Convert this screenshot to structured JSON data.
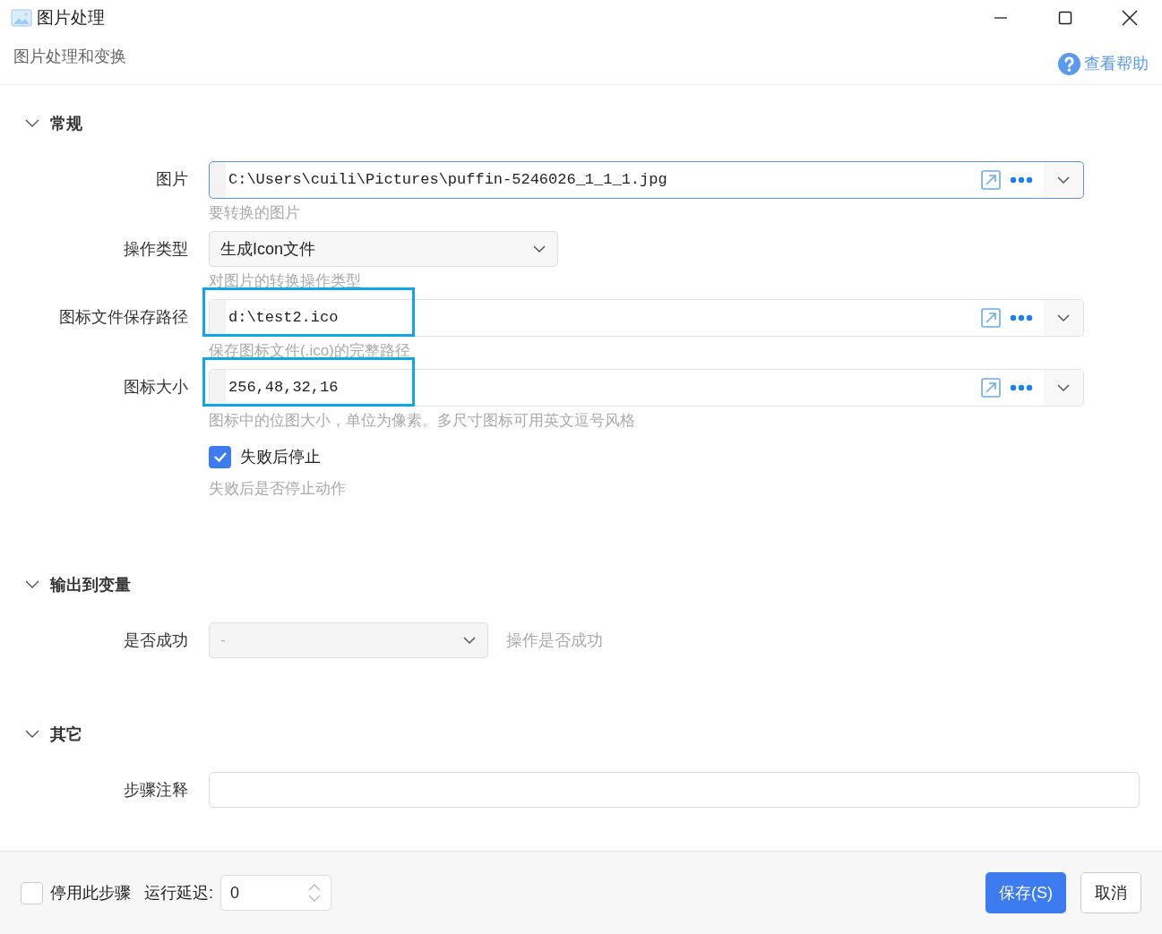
{
  "window": {
    "title": "图片处理",
    "subtitle": "图片处理和变换",
    "help": "查看帮助"
  },
  "sections": [
    {
      "title": "常规",
      "expanded": true,
      "fields": [
        {
          "kind": "path",
          "label": "图片",
          "value": "C:\\Users\\cuili\\Pictures\\puffin-5246026_1_1_1.jpg",
          "hint": "要转换的图片",
          "focused": true,
          "highlighted": false
        },
        {
          "kind": "select",
          "label": "操作类型",
          "value": "生成Icon文件",
          "hint": "对图片的转换操作类型"
        },
        {
          "kind": "path",
          "label": "图标文件保存路径",
          "value": "d:\\test2.ico",
          "hint": "保存图标文件(.ico)的完整路径",
          "focused": false,
          "highlighted": true
        },
        {
          "kind": "path",
          "label": "图标大小",
          "value": "256,48,32,16",
          "hint": "图标中的位图大小，单位为像素。多尺寸图标可用英文逗号风格",
          "focused": false,
          "highlighted": true
        },
        {
          "kind": "checkbox",
          "label": "失败后停止",
          "checked": true,
          "hint": "失败后是否停止动作"
        }
      ]
    },
    {
      "title": "输出到变量",
      "expanded": true,
      "fields": [
        {
          "kind": "variable",
          "label": "是否成功",
          "placeholder": "-",
          "note": "操作是否成功"
        }
      ]
    },
    {
      "title": "其它",
      "expanded": true,
      "fields": [
        {
          "kind": "text",
          "label": "步骤注释"
        }
      ]
    }
  ],
  "footer": {
    "disable": {
      "label": "停用此步骤",
      "checked": false
    },
    "delay": {
      "label": "运行延迟:",
      "value": "0"
    },
    "buttons": [
      {
        "label": "保存(S)",
        "primary": true
      },
      {
        "label": "取消",
        "primary": false
      }
    ]
  }
}
